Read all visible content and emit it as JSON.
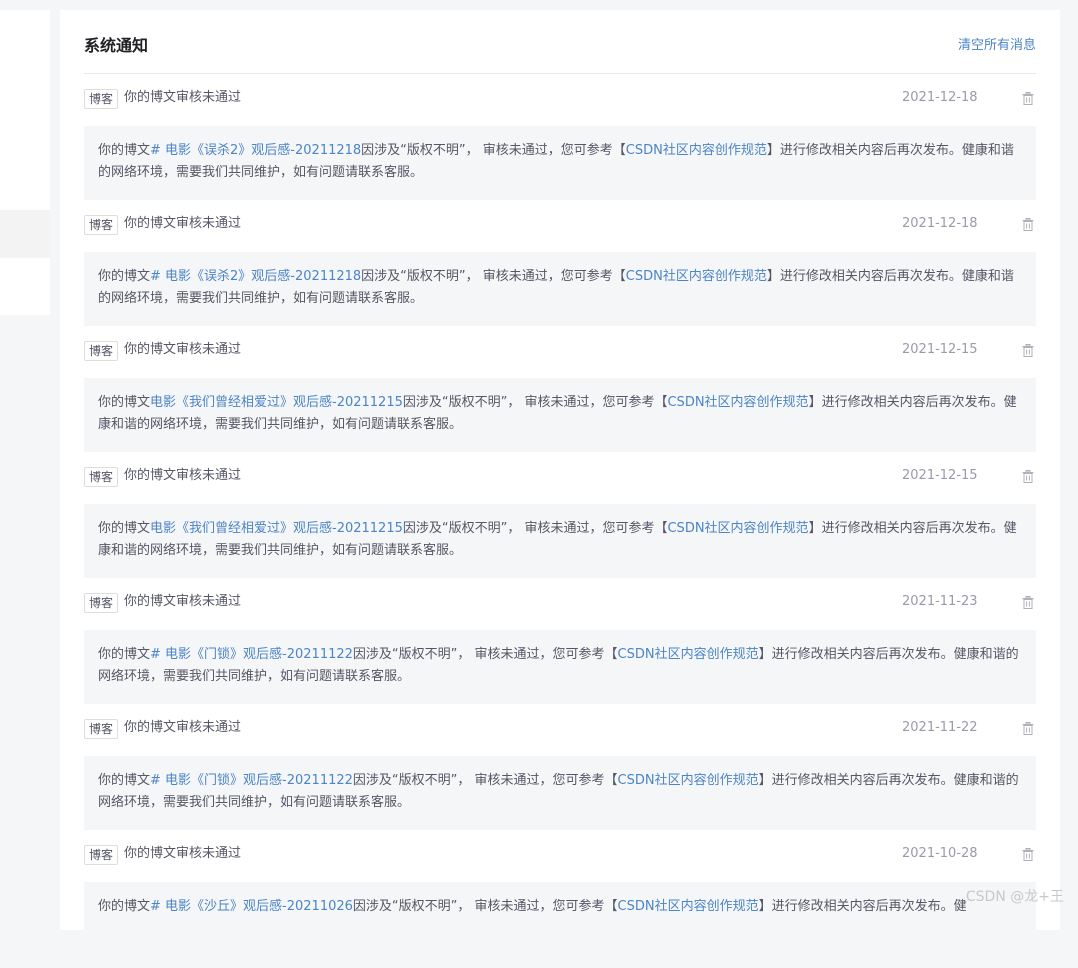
{
  "header": {
    "title": "系统通知",
    "clear_label": "清空所有消息"
  },
  "notices": [
    {
      "tag": "博客",
      "summary": "你的博文审核未通过",
      "date": "2021-12-18",
      "pre": "你的博文",
      "article": "# 电影《误杀2》观后感-20211218",
      "mid": "因涉及“版权不明”， 审核未通过，您可参考【",
      "guide": "CSDN社区内容创作规范",
      "post": "】进行修改相关内容后再次发布。健康和谐的网络环境，需要我们共同维护，如有问题请联系客服。"
    },
    {
      "tag": "博客",
      "summary": "你的博文审核未通过",
      "date": "2021-12-18",
      "pre": "你的博文",
      "article": "# 电影《误杀2》观后感-20211218",
      "mid": "因涉及“版权不明”， 审核未通过，您可参考【",
      "guide": "CSDN社区内容创作规范",
      "post": "】进行修改相关内容后再次发布。健康和谐的网络环境，需要我们共同维护，如有问题请联系客服。"
    },
    {
      "tag": "博客",
      "summary": "你的博文审核未通过",
      "date": "2021-12-15",
      "pre": "你的博文",
      "article": "电影《我们曾经相爱过》观后感-20211215",
      "mid": "因涉及“版权不明”， 审核未通过，您可参考【",
      "guide": "CSDN社区内容创作规范",
      "post": "】进行修改相关内容后再次发布。健康和谐的网络环境，需要我们共同维护，如有问题请联系客服。"
    },
    {
      "tag": "博客",
      "summary": "你的博文审核未通过",
      "date": "2021-12-15",
      "pre": "你的博文",
      "article": "电影《我们曾经相爱过》观后感-20211215",
      "mid": "因涉及“版权不明”， 审核未通过，您可参考【",
      "guide": "CSDN社区内容创作规范",
      "post": "】进行修改相关内容后再次发布。健康和谐的网络环境，需要我们共同维护，如有问题请联系客服。"
    },
    {
      "tag": "博客",
      "summary": "你的博文审核未通过",
      "date": "2021-11-23",
      "pre": "你的博文",
      "article": "# 电影《门锁》观后感-20211122",
      "mid": "因涉及“版权不明”， 审核未通过，您可参考【",
      "guide": "CSDN社区内容创作规范",
      "post": "】进行修改相关内容后再次发布。健康和谐的网络环境，需要我们共同维护，如有问题请联系客服。"
    },
    {
      "tag": "博客",
      "summary": "你的博文审核未通过",
      "date": "2021-11-22",
      "pre": "你的博文",
      "article": "# 电影《门锁》观后感-20211122",
      "mid": "因涉及“版权不明”， 审核未通过，您可参考【",
      "guide": "CSDN社区内容创作规范",
      "post": "】进行修改相关内容后再次发布。健康和谐的网络环境，需要我们共同维护，如有问题请联系客服。"
    },
    {
      "tag": "博客",
      "summary": "你的博文审核未通过",
      "date": "2021-10-28",
      "pre": "你的博文",
      "article": "# 电影《沙丘》观后感-20211026",
      "mid": "因涉及“版权不明”， 审核未通过，您可参考【",
      "guide": "CSDN社区内容创作规范",
      "post": "】进行修改相关内容后再次发布。健"
    }
  ],
  "watermark": "CSDN @龙+王",
  "icons": {
    "delete": "trash-icon"
  },
  "colors": {
    "link": "#4b84c7",
    "text": "#555666",
    "muted": "#999aaa",
    "detail_bg": "#f5f6f7"
  }
}
